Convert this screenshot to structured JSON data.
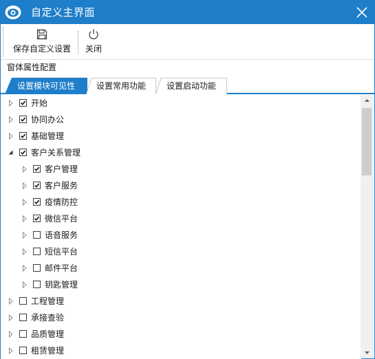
{
  "window": {
    "title": "自定义主界面",
    "accent_color": "#1f7ec9",
    "app_icon": "app-eye-logo-icon",
    "close_icon": "close-icon"
  },
  "toolbar": {
    "save_label": "保存自定义设置",
    "save_icon": "floppy-disk-icon",
    "close_label": "关闭",
    "close_icon": "power-icon"
  },
  "section": {
    "label": "窗体属性配置"
  },
  "tabs": [
    {
      "label": "设置模块可见性",
      "active": true
    },
    {
      "label": "设置常用功能",
      "active": false
    },
    {
      "label": "设置启动功能",
      "active": false
    }
  ],
  "tree": [
    {
      "label": "开始",
      "level": 0,
      "expanded": false,
      "checked": true
    },
    {
      "label": "协同办公",
      "level": 0,
      "expanded": false,
      "checked": true
    },
    {
      "label": "基础管理",
      "level": 0,
      "expanded": false,
      "checked": true
    },
    {
      "label": "客户关系管理",
      "level": 0,
      "expanded": true,
      "checked": true
    },
    {
      "label": "客户管理",
      "level": 1,
      "expanded": false,
      "checked": true
    },
    {
      "label": "客户服务",
      "level": 1,
      "expanded": false,
      "checked": true
    },
    {
      "label": "疫情防控",
      "level": 1,
      "expanded": false,
      "checked": true
    },
    {
      "label": "微信平台",
      "level": 1,
      "expanded": false,
      "checked": true
    },
    {
      "label": "语音服务",
      "level": 1,
      "expanded": false,
      "checked": false
    },
    {
      "label": "短信平台",
      "level": 1,
      "expanded": false,
      "checked": false
    },
    {
      "label": "邮件平台",
      "level": 1,
      "expanded": false,
      "checked": false
    },
    {
      "label": "钥匙管理",
      "level": 1,
      "expanded": false,
      "checked": false
    },
    {
      "label": "工程管理",
      "level": 0,
      "expanded": false,
      "checked": false
    },
    {
      "label": "承接查验",
      "level": 0,
      "expanded": false,
      "checked": false
    },
    {
      "label": "品质管理",
      "level": 0,
      "expanded": false,
      "checked": false
    },
    {
      "label": "租赁管理",
      "level": 0,
      "expanded": false,
      "checked": false
    }
  ]
}
